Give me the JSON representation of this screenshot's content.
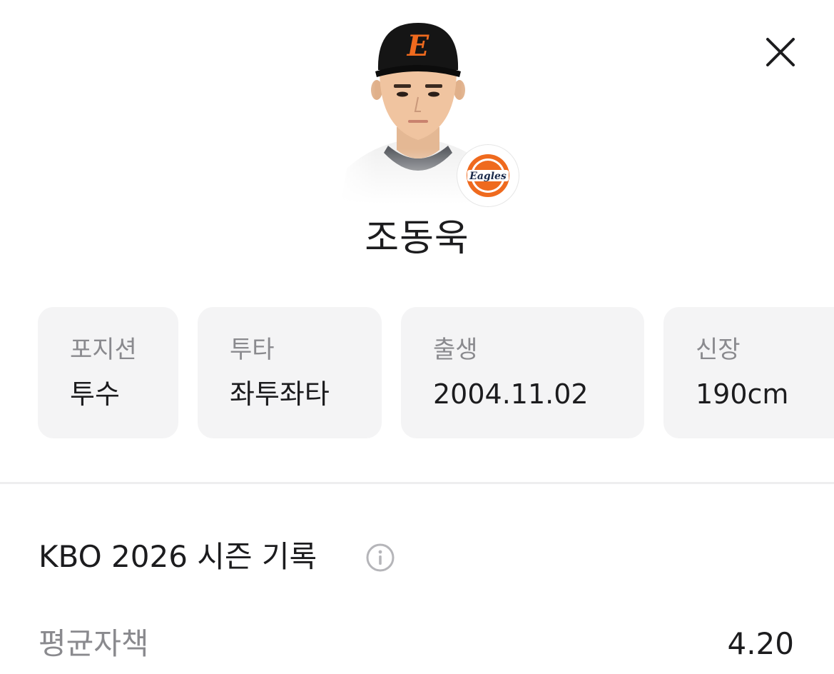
{
  "player": {
    "name": "조동욱",
    "photo_alt": "player photo",
    "team_logo_text": "Eagles",
    "cap_letter": "E"
  },
  "colors": {
    "accent_orange": "#ef6a1e",
    "cap_black": "#151515",
    "card_bg": "#f4f4f5",
    "label_gray": "#8a8a8e"
  },
  "icons": {
    "close": "close-icon",
    "info": "info-icon"
  },
  "info_cards": [
    {
      "label": "포지션",
      "value": "투수"
    },
    {
      "label": "투타",
      "value": "좌투좌타"
    },
    {
      "label": "출생",
      "value": "2004.11.02"
    },
    {
      "label": "신장",
      "value": "190cm"
    }
  ],
  "season": {
    "title": "KBO 2026 시즌 기록",
    "stats": [
      {
        "label": "평균자책",
        "value": "4.20"
      }
    ]
  }
}
